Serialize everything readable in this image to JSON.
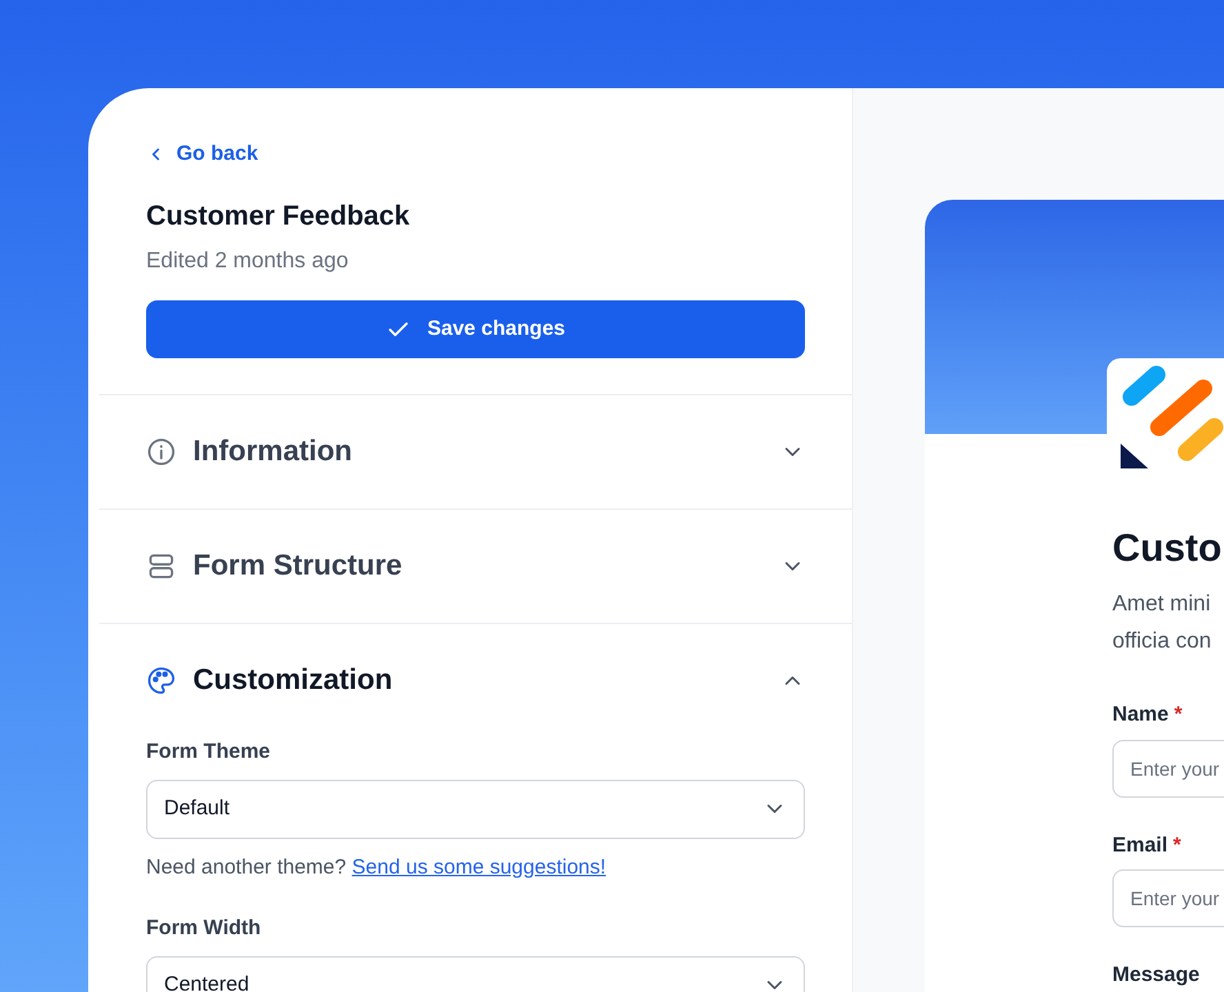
{
  "editor": {
    "back_link": "Go back",
    "title": "Customer Feedback",
    "subtitle": "Edited 2 months ago",
    "save_button": "Save changes",
    "sections": [
      {
        "title": "Information",
        "expanded": false
      },
      {
        "title": "Form Structure",
        "expanded": false
      },
      {
        "title": "Customization",
        "expanded": true
      }
    ],
    "customization": {
      "fields": [
        {
          "label": "Form Theme",
          "value": "Default",
          "help": "Need another theme?",
          "help_link": "Send us some suggestions!"
        },
        {
          "label": "Form Width",
          "value": "Centered"
        }
      ]
    }
  },
  "preview": {
    "title": "Custo",
    "description": [
      "Amet mini",
      "officia con"
    ],
    "fields": [
      {
        "label": "Name",
        "required_mark": "*",
        "placeholder": "Enter your"
      },
      {
        "label": "Email",
        "required_mark": "*",
        "placeholder": "Enter your"
      }
    ],
    "next_label": "Message"
  }
}
